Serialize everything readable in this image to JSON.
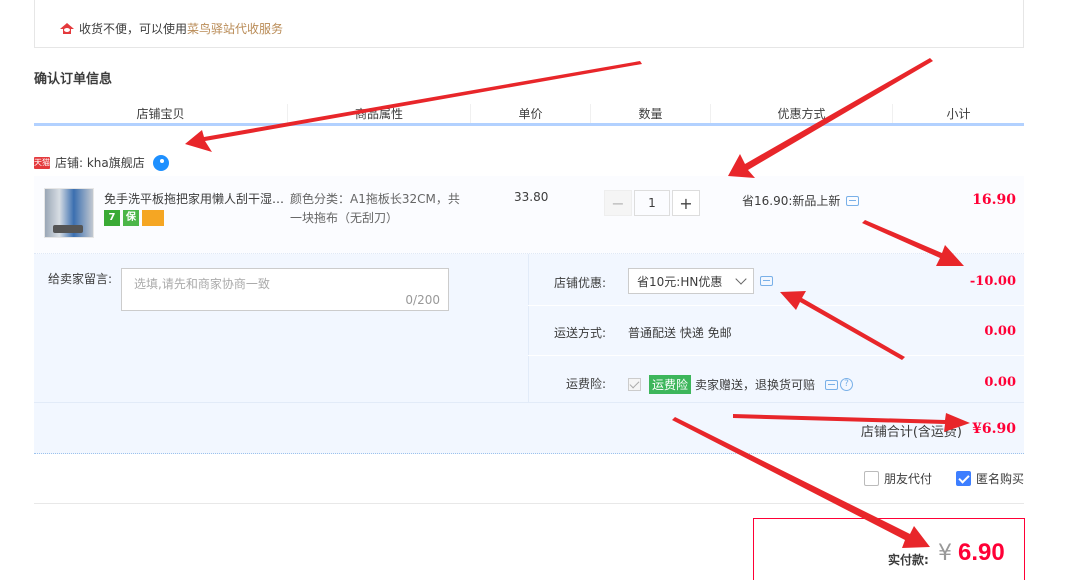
{
  "address": {
    "note_text": "收货不便，可以使用",
    "note_link": "菜鸟驿站代收服务"
  },
  "section_title": "确认订单信息",
  "columns": [
    "店铺宝贝",
    "商品属性",
    "单价",
    "数量",
    "优惠方式",
    "小计"
  ],
  "shop": {
    "badge": "天猫",
    "name": "店铺: kha旗舰店"
  },
  "item": {
    "title": "免手洗平板拖把家用懒人刮干湿…",
    "icons": {
      "seven": "7",
      "guarantee": "保"
    },
    "attr": "颜色分类：A1拖板长32CM，共一块拖布（无刮刀）",
    "price": "33.80",
    "qty": {
      "minus": "−",
      "value": "1",
      "plus": "+"
    },
    "promo": "省16.90:新品上新",
    "subtotal": "16.90"
  },
  "memo": {
    "label": "给卖家留言:",
    "placeholder": "选填,请先和商家协商一致",
    "count": "0/200"
  },
  "shop_discount": {
    "label": "店铺优惠:",
    "selected": "省10元:HN优惠",
    "amount": "-10.00"
  },
  "shipping": {
    "label": "运送方式:",
    "value": "普通配送 快递 免邮",
    "amount": "0.00"
  },
  "insurance": {
    "label": "运费险:",
    "tag": "运费险",
    "text": "卖家赠送，退换货可赔",
    "help": "?",
    "amount": "0.00"
  },
  "shop_total": {
    "label": "店铺合计(含运费)",
    "amount": "¥6.90"
  },
  "options": {
    "friend_pay": "朋友代付",
    "anonymous": "匿名购买"
  },
  "pay": {
    "label": "实付款:",
    "currency": "¥",
    "amount": "6.90"
  },
  "colors": {
    "accent_red": "#ff0036",
    "link_brown": "#b98b56",
    "header_rule": "#b2d1ff",
    "panel_bg": "#f2f7ff",
    "arrow_red": "#e8262a"
  }
}
